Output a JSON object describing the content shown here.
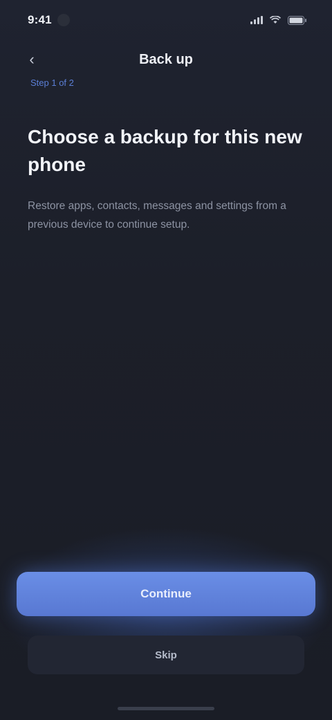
{
  "status_bar": {
    "time": "9:41"
  },
  "header": {
    "back_label": "‹",
    "title": "Back up"
  },
  "step": {
    "text": "Step 1 of 2"
  },
  "content": {
    "heading": "Choose a backup for this new phone",
    "body": "Restore apps, contacts, messages and settings from a previous device to continue setup."
  },
  "actions": {
    "primary_label": "Continue",
    "secondary_label": "Skip"
  },
  "colors": {
    "background": "#1c1f28",
    "accent": "#5f82dc"
  },
  "icons": {
    "back": "chevron-left-icon",
    "signal": "signal-icon",
    "wifi": "wifi-icon",
    "battery": "battery-icon"
  }
}
